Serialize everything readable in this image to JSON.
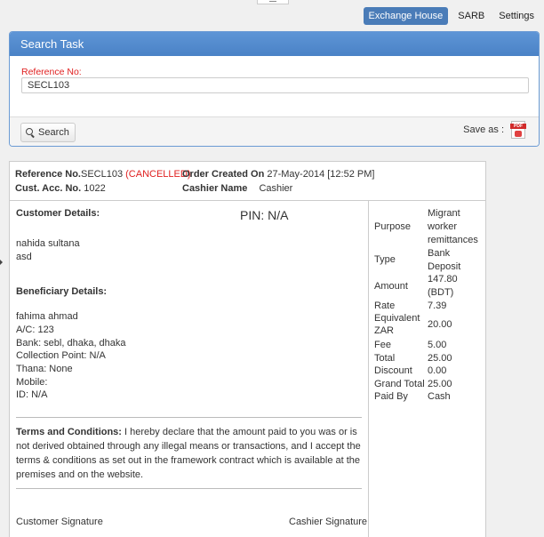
{
  "topnav": {
    "items": [
      {
        "label": "Exchange House",
        "active": true
      },
      {
        "label": "SARB",
        "active": false
      },
      {
        "label": "Settings",
        "active": false
      }
    ]
  },
  "search_panel": {
    "title": "Search Task",
    "reference_label": "Reference No:",
    "reference_value": "SECL103",
    "search_button": "Search",
    "save_as_label": "Save as :",
    "pdf_icon_text": "PDF"
  },
  "receipt": {
    "reference_label": "Reference No.",
    "reference_value": "SECL103",
    "status": "(CANCELLED)",
    "order_created_label": "Order Created On",
    "order_created_value": "27-May-2014 [12:52 PM]",
    "cust_acc_label": "Cust. Acc. No.",
    "cust_acc_value": "1022",
    "cashier_label": "Cashier Name",
    "cashier_value": "Cashier",
    "customer_title": "Customer Details:",
    "pin": "PIN: N/A",
    "customer_name": "nahida sultana",
    "customer_address": "asd",
    "beneficiary_title": "Beneficiary Details:",
    "beneficiary_lines": [
      "fahima ahmad",
      "A/C: 123",
      "Bank: sebl, dhaka, dhaka",
      "Collection Point: N/A",
      "Thana: None",
      "Mobile:",
      "ID: N/A"
    ],
    "terms_label": "Terms and Conditions:",
    "terms_text": " I hereby declare that the amount paid to you was or is not derived obtained through any illegal means or transactions, and I accept the terms & conditions as set out in the framework contract which is available at the premises and on the website.",
    "customer_signature": "Customer Signature",
    "cashier_signature": "Cashier Signature",
    "summary": [
      {
        "key": "Purpose",
        "value": "Migrant worker remittances"
      },
      {
        "key": "Type",
        "value": "Bank Deposit"
      },
      {
        "key": "Amount",
        "value": "147.80 (BDT)"
      },
      {
        "key": "Rate",
        "value": "7.39"
      },
      {
        "key": "Equivalent ZAR",
        "value": "20.00"
      },
      {
        "key": "Fee",
        "value": "5.00"
      },
      {
        "key": "Total",
        "value": "25.00"
      },
      {
        "key": "Discount",
        "value": "0.00"
      },
      {
        "key": "Grand Total",
        "value": "25.00"
      },
      {
        "key": "Paid By",
        "value": "Cash"
      }
    ]
  }
}
